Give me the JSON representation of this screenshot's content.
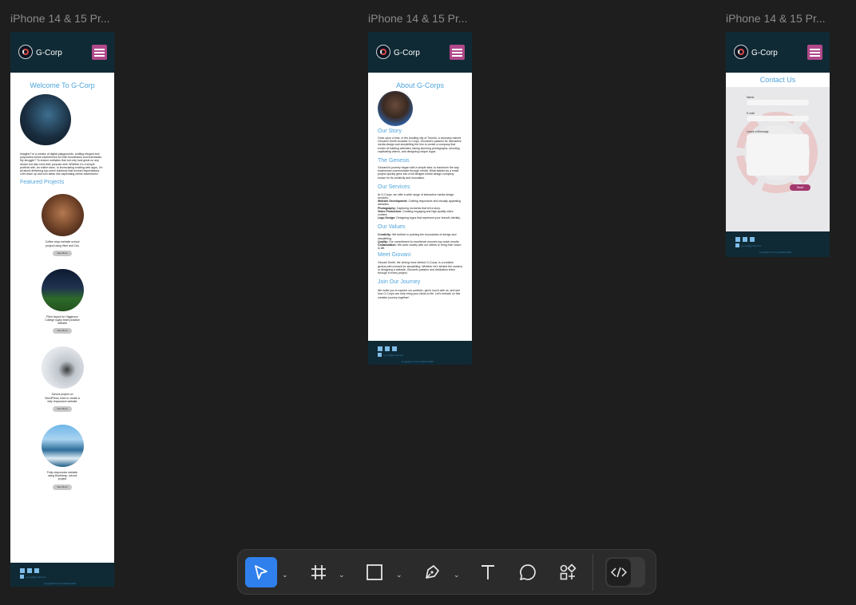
{
  "frames": [
    {
      "label": "iPhone 14 & 15 Pr..."
    },
    {
      "label": "iPhone 14 & 15 Pr..."
    },
    {
      "label": "iPhone 14 & 15 Pr..."
    }
  ],
  "site": {
    "brand": "G-Corp"
  },
  "home": {
    "title": "Welcome To G-Corp",
    "intro": "Imagine I'm a creator of digital playgrounds, crafting elegant and purposeful online experiences for both businesses and individuals. My struggle? To ensure websites that not only look great on any device but also hold their purpose well. Whether it's a simple portfolio site, an online store, or showcasing exciting web apps, I'm all about delivering top-notch solutions that exceed expectations. Let's team up and turn ideas into captivating online adventures!",
    "featured_title": "Featured Projects",
    "projects": [
      {
        "caption": "Coffee shop website school project using Html and Css",
        "button": "See More"
      },
      {
        "caption": "Pitch layout for Higginson College rugby team practice website",
        "button": "See More"
      },
      {
        "caption": "School project on WordPress, tried to create a fully responsive website",
        "button": "See More"
      },
      {
        "caption": "Fully responsive website using Bootstrap, school project",
        "button": "See More"
      }
    ]
  },
  "about": {
    "title": "About G-Corps",
    "story_title": "Our Story",
    "story_text": "Once upon a time, in the bustling city of Toronto, a visionary named Giovanni Smith founded G-Corps. Giovanni's passion for interactive media design and storytelling fed him to create a company that excels at building websites, taking stunning photographs, shooting captivating videos, and designing unique logos.",
    "genesis_title": "The Genesis",
    "genesis_text": "Giovanni's journey began with a simple idea: to transform the way businesses communicate through media. What started as a small project quickly grew into a full-fledged media design company known for its creativity and innovation.",
    "services_title": "Our Services",
    "services_intro": "At G-Corps, we offer a wide range of interactive media design services:",
    "services": [
      {
        "label": "Website Development:",
        "text": "Crafting responsive and visually appealing websites."
      },
      {
        "label": "Photography:",
        "text": "Capturing moments that tell a story."
      },
      {
        "label": "Video Production:",
        "text": "Creating engaging and high-quality video content."
      },
      {
        "label": "Logo Design:",
        "text": "Designing logos that represent your brand's identity."
      }
    ],
    "values_title": "Our Values",
    "values": [
      {
        "label": "Creativity:",
        "text": "We believe in pushing the boundaries of design and storytelling."
      },
      {
        "label": "Quality:",
        "text": "Our commitment to excellence ensures top-notch results."
      },
      {
        "label": "Collaboration:",
        "text": "We work closely with our clients to bring their vision to life."
      }
    ],
    "meet_title": "Meet Giovani",
    "meet_text": "Giovani Smith, the driving force behind G-Corps, is a creative genius with a knack for storytelling. Whether he's behind the camera or designing a website, Giovani's passion and dedication shine through in every project.",
    "journey_title": "Join Our Journey",
    "journey_text": "We invite you to explore our portfolio, get in touch with us, and see how G-Corps can help bring your ideas to life. Let's embark on this creative journey together!"
  },
  "contact": {
    "title": "Contact Us",
    "name_label": "Name",
    "email_label": "E-mail",
    "message_label": "Leave a Message",
    "send_button": "Send"
  },
  "footer": {
    "email": "g-corp@gmail.com",
    "copyright": "Copyright G-Corp Media 2024"
  },
  "toolbar": {
    "tools": [
      "move-tool",
      "frame-tool",
      "shape-tool",
      "pen-tool",
      "text-tool",
      "comment-tool",
      "actions-tool",
      "dev-mode-toggle"
    ]
  }
}
